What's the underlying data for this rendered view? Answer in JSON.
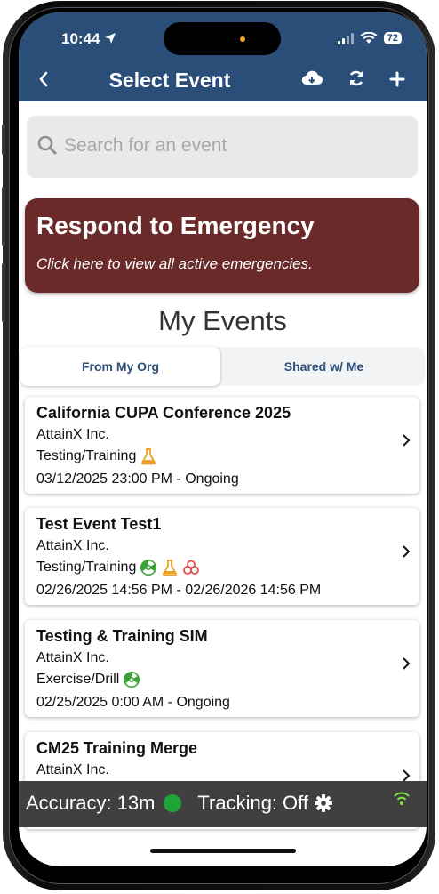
{
  "status_bar": {
    "time": "10:44",
    "battery": "72"
  },
  "nav": {
    "title": "Select Event",
    "back_icon": "chevron-left-icon",
    "icons": [
      "cloud-download-icon",
      "refresh-icon",
      "plus-icon"
    ]
  },
  "search": {
    "placeholder": "Search for an event"
  },
  "emergency": {
    "title": "Respond to Emergency",
    "subtitle": "Click here to view all active emergencies."
  },
  "section_title": "My Events",
  "tabs": [
    {
      "label": "From My Org",
      "active": true
    },
    {
      "label": "Shared w/ Me",
      "active": false
    }
  ],
  "events": [
    {
      "title": "California CUPA Conference 2025",
      "org": "AttainX Inc.",
      "type": "Testing/Training",
      "icons": [
        "flask-icon"
      ],
      "dates": "03/12/2025 23:00 PM - Ongoing"
    },
    {
      "title": "Test Event Test1",
      "org": "AttainX Inc.",
      "type": "Testing/Training",
      "icons": [
        "radiation-icon",
        "flask-icon",
        "biohazard-icon"
      ],
      "dates": "02/26/2025 14:56 PM - 02/26/2026 14:56 PM"
    },
    {
      "title": "Testing & Training SIM",
      "org": "AttainX Inc.",
      "type": "Exercise/Drill",
      "icons": [
        "radiation-icon"
      ],
      "dates": "02/25/2025 0:00 AM - Ongoing"
    },
    {
      "title": "CM25 Training Merge",
      "org": "AttainX Inc.",
      "type": "",
      "icons": [],
      "dates": ""
    }
  ],
  "footer": {
    "accuracy_label": "Accuracy:",
    "accuracy_value": "13m",
    "tracking_label": "Tracking:",
    "tracking_value": "Off"
  },
  "colors": {
    "nav_bg": "#2a4e78",
    "emergency_bg": "#6b2a2a",
    "footer_bg": "#404040",
    "accuracy_dot": "#22a33a",
    "wifi": "#7ee83c"
  }
}
